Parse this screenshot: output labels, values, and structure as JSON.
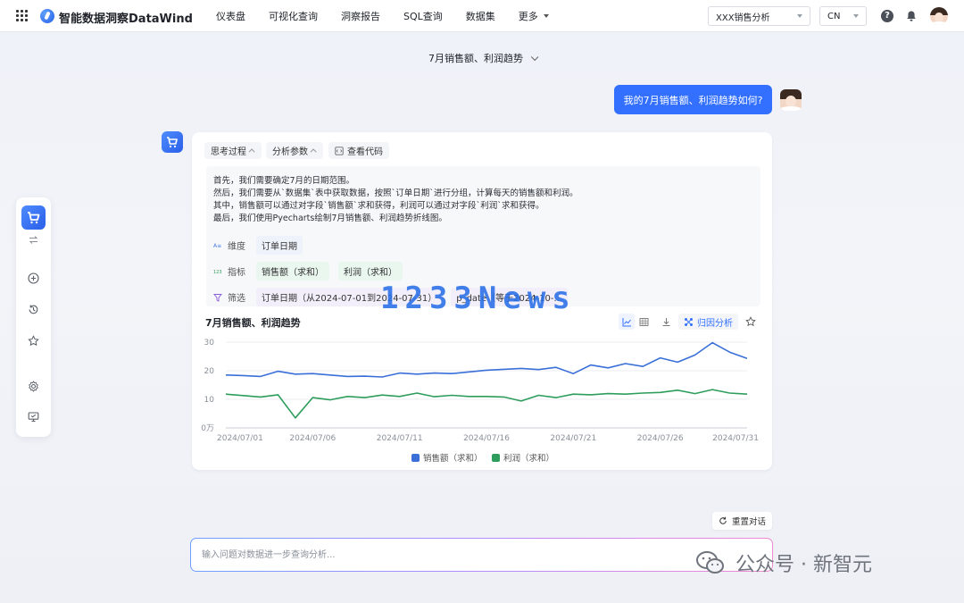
{
  "app": {
    "title": "智能数据洞察DataWind"
  },
  "nav": [
    {
      "label": "仪表盘"
    },
    {
      "label": "可视化查询"
    },
    {
      "label": "洞察报告"
    },
    {
      "label": "SQL查询"
    },
    {
      "label": "数据集"
    },
    {
      "label": "更多"
    }
  ],
  "topbar": {
    "project_select": "XXX销售分析",
    "lang_select": "CN"
  },
  "conversation": {
    "title": "7月销售额、利润趋势",
    "user_message": "我的7月销售额、利润趋势如何?"
  },
  "card": {
    "tabs": {
      "thinking": "思考过程",
      "params": "分析参数",
      "code": "查看代码"
    },
    "thought_lines": [
      "首先，我们需要确定7月的日期范围。",
      "然后，我们需要从`数据集`表中获取数据，按照`订单日期`进行分组，计算每天的销售额和利润。",
      "其中，销售额可以通过对字段`销售额`求和获得，利润可以通过对字段`利润`求和获得。",
      "最后，我们使用Pyecharts绘制7月销售额、利润趋势折线图。"
    ],
    "params": {
      "dimension_label": "维度",
      "dimension_tag": "订单日期",
      "metric_label": "指标",
      "metric_tags": [
        "销售额（求和）",
        "利润（求和）"
      ],
      "filter_label": "筛选",
      "filter_tag": "订单日期（从2024-07-01到2024-07-31）",
      "filter_tag_2": "p_date（等于2024-10-..."
    },
    "attribution_label": "归因分析"
  },
  "chart_data": {
    "type": "line",
    "title": "7月销售额、利润趋势",
    "xlabel": "",
    "ylabel": "",
    "ylim": [
      0,
      30
    ],
    "ytick_labels": [
      "0万",
      "10",
      "20",
      "30"
    ],
    "yticks": [
      0,
      10,
      20,
      30
    ],
    "x": [
      "2024/07/01",
      "2024/07/02",
      "2024/07/03",
      "2024/07/04",
      "2024/07/05",
      "2024/07/06",
      "2024/07/07",
      "2024/07/08",
      "2024/07/09",
      "2024/07/10",
      "2024/07/11",
      "2024/07/12",
      "2024/07/13",
      "2024/07/14",
      "2024/07/15",
      "2024/07/16",
      "2024/07/17",
      "2024/07/18",
      "2024/07/19",
      "2024/07/20",
      "2024/07/21",
      "2024/07/22",
      "2024/07/23",
      "2024/07/24",
      "2024/07/25",
      "2024/07/26",
      "2024/07/27",
      "2024/07/28",
      "2024/07/29",
      "2024/07/30",
      "2024/07/31"
    ],
    "xtick_labels": [
      "2024/07/01",
      "2024/07/06",
      "2024/07/11",
      "2024/07/16",
      "2024/07/21",
      "2024/07/26",
      "2024/07/31"
    ],
    "series": [
      {
        "name": "销售额（求和）",
        "color": "#3a6fd8",
        "values": [
          18.5,
          18.3,
          18.0,
          19.8,
          18.8,
          19.0,
          18.5,
          18.0,
          18.1,
          17.8,
          19.2,
          18.8,
          19.2,
          19.0,
          19.6,
          20.2,
          20.5,
          20.8,
          20.4,
          21.2,
          19.0,
          22.0,
          21.0,
          22.5,
          21.5,
          24.5,
          23.0,
          25.5,
          29.8,
          26.5,
          24.3
        ]
      },
      {
        "name": "利润（求和）",
        "color": "#2e9d5b",
        "values": [
          11.8,
          11.3,
          10.8,
          11.6,
          3.5,
          10.6,
          9.8,
          11.0,
          10.6,
          11.5,
          11.0,
          12.2,
          10.9,
          11.4,
          11.0,
          11.0,
          10.8,
          9.4,
          11.4,
          10.6,
          11.8,
          11.6,
          12.0,
          11.8,
          12.2,
          12.4,
          13.2,
          12.0,
          13.4,
          12.2,
          11.8
        ]
      }
    ],
    "grid": true,
    "legend": "bottom"
  },
  "footer": {
    "reset_label": "重置对话",
    "input_placeholder": "输入问题对数据进一步查询分析...",
    "watermark_text": "1233News",
    "brand_text": "公众号 · 新智元"
  },
  "colors": {
    "accent": "#3370ff",
    "sales": "#3a6fd8",
    "profit": "#2e9d5b"
  }
}
